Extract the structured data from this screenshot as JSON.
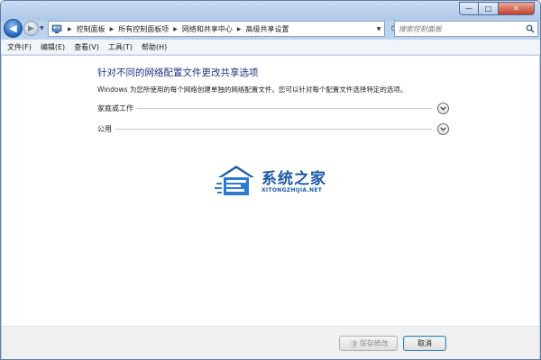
{
  "window": {
    "controls": {
      "minimize": "—",
      "maximize": "□",
      "close": "✕"
    }
  },
  "nav": {
    "back_icon": "back-arrow-icon",
    "forward_icon": "forward-arrow-icon"
  },
  "address": {
    "breadcrumbs": [
      "控制面板",
      "所有控制面板项",
      "网络和共享中心",
      "高级共享设置"
    ]
  },
  "search": {
    "placeholder": "搜索控制面板"
  },
  "menu": {
    "items": [
      "文件(F)",
      "编辑(E)",
      "查看(V)",
      "工具(T)",
      "帮助(H)"
    ]
  },
  "main": {
    "title": "针对不同的网络配置文件更改共享选项",
    "description": "Windows 为您所使用的每个网络创建单独的网络配置文件。您可以针对每个配置文件选择特定的选项。",
    "sections": [
      {
        "label": "家庭或工作"
      },
      {
        "label": "公用"
      }
    ]
  },
  "watermark": {
    "text": "系统之家",
    "subtext": "XITONGZHIJIA.NET"
  },
  "footer": {
    "save_label": "保存修改",
    "cancel_label": "取消"
  },
  "colors": {
    "title_blue": "#1e3287",
    "watermark_blue": "#1b5aa6",
    "frame": "#bcd3ee"
  }
}
